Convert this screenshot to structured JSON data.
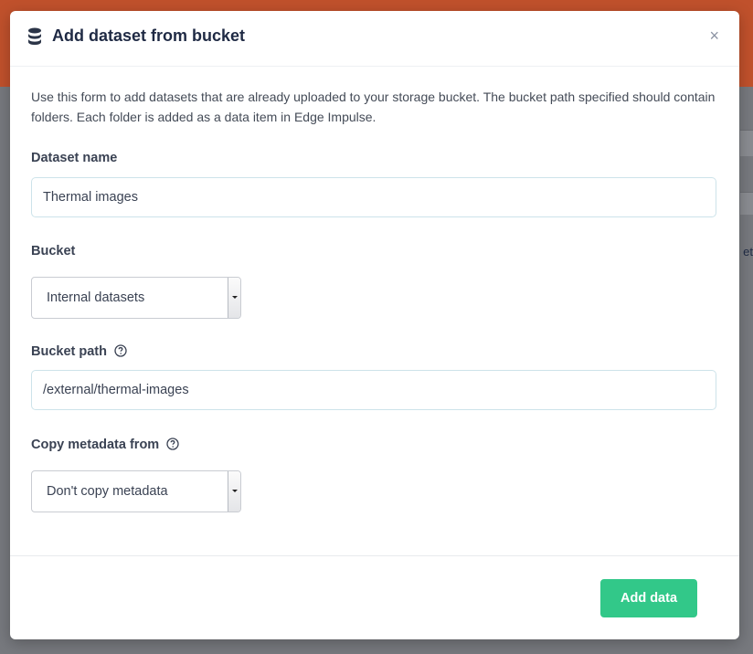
{
  "background": {
    "edge_text": "et"
  },
  "modal": {
    "title": "Add dataset from bucket",
    "header_icon": "database-icon",
    "close_icon": "close-icon",
    "close_label": "×",
    "description": "Use this form to add datasets that are already uploaded to your storage bucket. The bucket path specified should contain folders. Each folder is added as a data item in Edge Impulse."
  },
  "form": {
    "dataset_name": {
      "label": "Dataset name",
      "value": "Thermal images"
    },
    "bucket": {
      "label": "Bucket",
      "selected": "Internal datasets"
    },
    "bucket_path": {
      "label": "Bucket path",
      "value": "/external/thermal-images",
      "help_icon": "question-circle-icon"
    },
    "copy_metadata": {
      "label": "Copy metadata from",
      "selected": "Don't copy metadata",
      "help_icon": "question-circle-icon"
    }
  },
  "footer": {
    "submit_label": "Add data"
  },
  "colors": {
    "header_bar": "#c0512c",
    "primary_button": "#32c889",
    "title_text": "#1f2a44"
  }
}
